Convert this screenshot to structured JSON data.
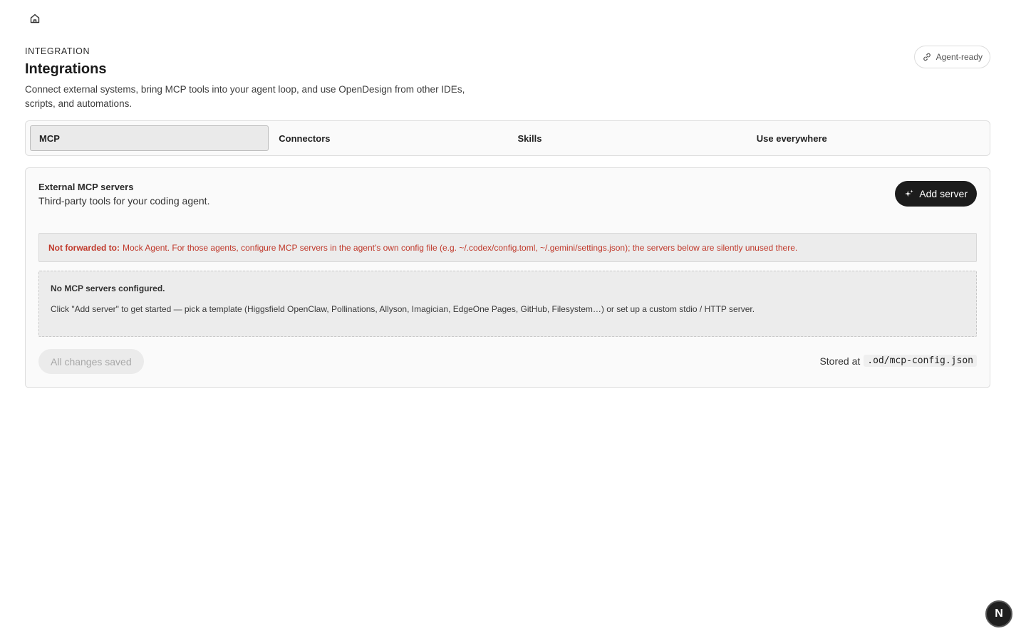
{
  "nav": {
    "home_icon": "home-icon"
  },
  "header": {
    "eyebrow": "INTEGRATION",
    "title": "Integrations",
    "description": "Connect external systems, bring MCP tools into your agent loop, and use OpenDesign from other IDEs, scripts, and automations.",
    "badge_label": "Agent-ready",
    "badge_icon": "link-icon"
  },
  "tabs": [
    {
      "label": "MCP",
      "active": true
    },
    {
      "label": "Connectors",
      "active": false
    },
    {
      "label": "Skills",
      "active": false
    },
    {
      "label": "Use everywhere",
      "active": false
    }
  ],
  "mcp": {
    "title": "External MCP servers",
    "subtitle": "Third-party tools for your coding agent.",
    "add_button": "Add server",
    "add_icon": "sparkle-icon",
    "warning": {
      "label": "Not forwarded to:",
      "text": "Mock Agent. For those agents, configure MCP servers in the agent's own config file (e.g. ~/.codex/config.toml, ~/.gemini/settings.json); the servers below are silently unused there."
    },
    "empty": {
      "title": "No MCP servers configured.",
      "text": "Click \"Add server\" to get started — pick a template (Higgsfield OpenClaw, Pollinations, Allyson, Imagician, EdgeOne Pages, GitHub, Filesystem…) or set up a custom stdio / HTTP server."
    },
    "save_status": "All changes saved",
    "stored_label": "Stored at",
    "stored_path": ".od/mcp-config.json"
  },
  "fab": {
    "letter": "N"
  },
  "colors": {
    "warning_text": "#c0392b",
    "primary_button": "#1c1c1c"
  }
}
